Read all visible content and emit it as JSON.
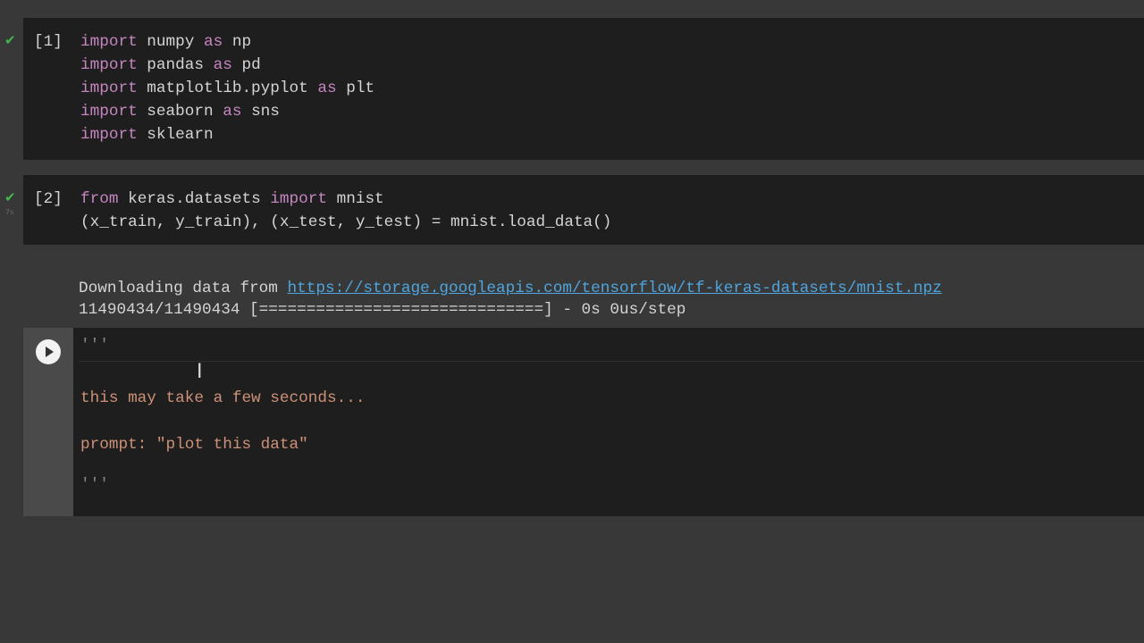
{
  "cells": [
    {
      "exec_count": "[1]",
      "status": "✔",
      "lines": [
        [
          "import",
          " numpy ",
          "as",
          " np"
        ],
        [
          "import",
          " pandas ",
          "as",
          " pd"
        ],
        [
          "import",
          " matplotlib.pyplot ",
          "as",
          " plt"
        ],
        [
          "import",
          " seaborn ",
          "as",
          " sns"
        ],
        [
          "import",
          " sklearn",
          "",
          ""
        ]
      ]
    },
    {
      "exec_count": "[2]",
      "status": "✔",
      "time": "7s",
      "lines": [
        [
          "from",
          " keras.datasets ",
          "import",
          " mnist"
        ],
        [
          "",
          "(x_train, y_train), (x_test, y_test) = mnist.load_data()",
          "",
          ""
        ]
      ],
      "output": {
        "prefix": "Downloading data from ",
        "link": "https://storage.googleapis.com/tensorflow/tf-keras-datasets/mnist.npz",
        "progress": "11490434/11490434 [==============================] - 0s 0us/step"
      }
    },
    {
      "lines": [
        "'''",
        "this may take a few seconds...",
        "prompt: \"plot this data\"",
        "'''"
      ]
    }
  ]
}
